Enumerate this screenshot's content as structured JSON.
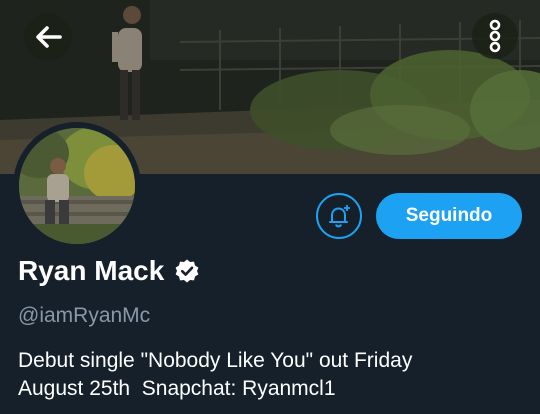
{
  "header": {
    "back_icon": "arrow-left-icon",
    "more_icon": "more-vertical-icon"
  },
  "profile": {
    "display_name": "Ryan Mack",
    "verified_icon": "verified-badge-icon",
    "handle": "@iamRyanMc",
    "bio_line_1": "Debut single \"Nobody Like You\" out Friday",
    "bio_line_2": "August 25th  Snapchat: Ryanmcl1"
  },
  "actions": {
    "notify_icon": "bell-plus-icon",
    "follow_label": "Seguindo"
  },
  "colors": {
    "background": "#15202b",
    "accent": "#1da1f2",
    "secondary_text": "#8899a6",
    "primary_text": "#ffffff"
  }
}
